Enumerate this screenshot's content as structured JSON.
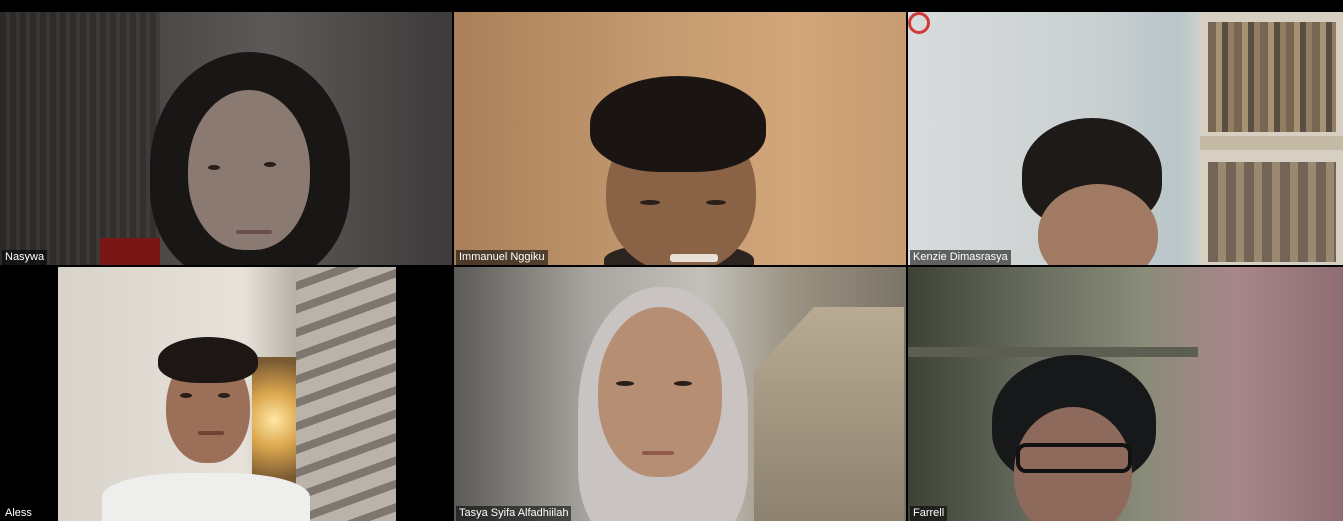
{
  "app": "video-conference-gallery-view",
  "participants": [
    {
      "name": "Nasywa"
    },
    {
      "name": "Immanuel Nggiku"
    },
    {
      "name": "Kenzie Dimasrasya"
    },
    {
      "name": "Aless"
    },
    {
      "name": "Tasya Syifa Alfadhiilah"
    },
    {
      "name": "Farrell"
    }
  ],
  "colors": {
    "background": "#000000",
    "name_tag_bg": "rgba(0,0,0,0.55)",
    "name_tag_text": "#ffffff"
  }
}
